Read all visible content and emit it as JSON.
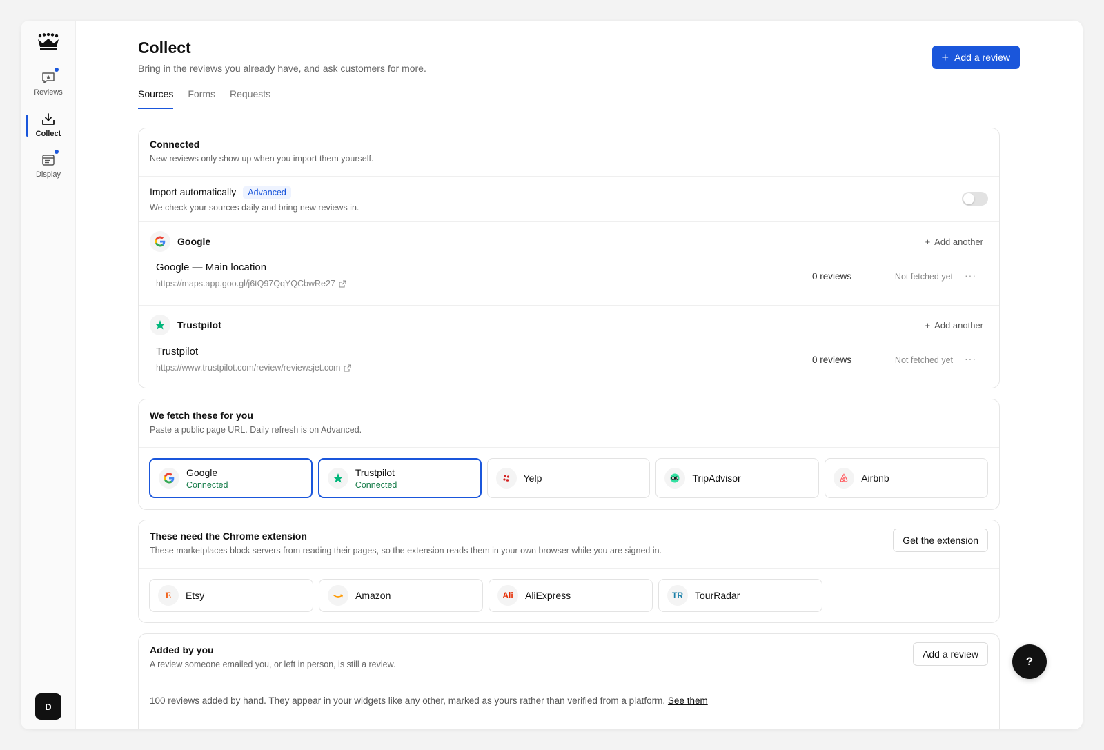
{
  "sidebar": {
    "logo_icon": "crown-icon",
    "items": [
      {
        "label": "Reviews",
        "icon": "chat-star-icon",
        "dot": true
      },
      {
        "label": "Collect",
        "icon": "download-icon",
        "active": true
      },
      {
        "label": "Display",
        "icon": "layout-icon",
        "dot": true
      }
    ],
    "avatar_initial": "D"
  },
  "header": {
    "title": "Collect",
    "subtitle": "Bring in the reviews you already have, and ask customers for more.",
    "tabs": [
      "Sources",
      "Forms",
      "Requests"
    ],
    "active_tab": "Sources",
    "add_review_label": "Add a review"
  },
  "connected": {
    "title": "Connected",
    "desc": "New reviews only show up when you import them yourself.",
    "auto_title": "Import automatically",
    "auto_badge": "Advanced",
    "auto_desc": "We check your sources daily and bring new reviews in.",
    "auto_enabled": false,
    "add_another_label": "Add another",
    "sources": [
      {
        "name": "Google",
        "location": "Google — Main location",
        "url": "https://maps.app.goo.gl/j6tQ97QqYQCbwRe27",
        "reviews": "0 reviews",
        "status": "Not fetched yet"
      },
      {
        "name": "Trustpilot",
        "location": "Trustpilot",
        "url": "https://www.trustpilot.com/review/reviewsjet.com",
        "reviews": "0 reviews",
        "status": "Not fetched yet"
      }
    ]
  },
  "fetch": {
    "title": "We fetch these for you",
    "desc": "Paste a public page URL. Daily refresh is on Advanced.",
    "platforms": [
      {
        "name": "Google",
        "status": "Connected"
      },
      {
        "name": "Trustpilot",
        "status": "Connected"
      },
      {
        "name": "Yelp"
      },
      {
        "name": "TripAdvisor"
      },
      {
        "name": "Airbnb"
      }
    ]
  },
  "extension": {
    "title": "These need the Chrome extension",
    "desc": "These marketplaces block servers from reading their pages, so the extension reads them in your own browser while you are signed in.",
    "button_label": "Get the extension",
    "platforms": [
      {
        "name": "Etsy",
        "glyph": "E"
      },
      {
        "name": "Amazon",
        "glyph": ""
      },
      {
        "name": "AliExpress",
        "glyph": "Ali"
      },
      {
        "name": "TourRadar",
        "glyph": "TR"
      }
    ]
  },
  "manual": {
    "title": "Added by you",
    "desc": "A review someone emailed you, or left in person, is still a review.",
    "button_label": "Add a review",
    "note": "100 reviews added by hand. They appear in your widgets like any other, marked as yours rather than verified from a platform.",
    "link_label": "See them"
  },
  "help_label": "?",
  "colors": {
    "accent": "#1a56db",
    "connected_text": "#127a46"
  }
}
